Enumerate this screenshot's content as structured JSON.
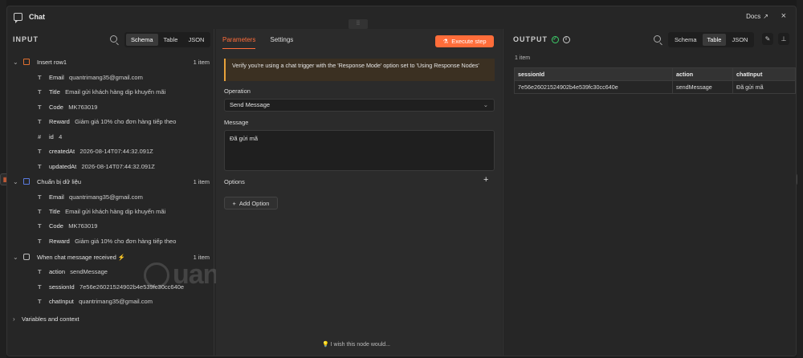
{
  "window": {
    "title": "Chat",
    "docs_label": "Docs",
    "close_glyph": "×"
  },
  "input": {
    "title": "INPUT",
    "view_tabs": [
      "Schema",
      "Table",
      "JSON"
    ],
    "nodes": [
      {
        "name": "Insert row1",
        "count": "1 item",
        "fields": [
          {
            "type": "T",
            "key": "Email",
            "value": "quantrimang35@gmail.com"
          },
          {
            "type": "T",
            "key": "Title",
            "value": "Email gửi khách hàng dịp khuyến mãi"
          },
          {
            "type": "T",
            "key": "Code",
            "value": "MK763019"
          },
          {
            "type": "T",
            "key": "Reward",
            "value": "Giảm giá 10% cho đơn hàng tiếp theo"
          },
          {
            "type": "#",
            "key": "id",
            "value": "4"
          },
          {
            "type": "T",
            "key": "createdAt",
            "value": "2026-08-14T07:44:32.091Z"
          },
          {
            "type": "T",
            "key": "updatedAt",
            "value": "2026-08-14T07:44:32.091Z"
          }
        ]
      },
      {
        "name": "Chuẩn bị dữ liệu",
        "count": "1 item",
        "fields": [
          {
            "type": "T",
            "key": "Email",
            "value": "quantrimang35@gmail.com"
          },
          {
            "type": "T",
            "key": "Title",
            "value": "Email gửi khách hàng dịp khuyến mãi"
          },
          {
            "type": "T",
            "key": "Code",
            "value": "MK763019"
          },
          {
            "type": "T",
            "key": "Reward",
            "value": "Giảm giá 10% cho đơn hàng tiếp theo"
          }
        ]
      },
      {
        "name": "When chat message received",
        "count": "1 item",
        "fields": [
          {
            "type": "T",
            "key": "action",
            "value": "sendMessage"
          },
          {
            "type": "T",
            "key": "sessionId",
            "value": "7e56e26021524902b4e539fc30cc640e"
          },
          {
            "type": "T",
            "key": "chatInput",
            "value": "quantrimang35@gmail.com"
          }
        ]
      }
    ],
    "variables_label": "Variables and context"
  },
  "params": {
    "tabs": [
      "Parameters",
      "Settings"
    ],
    "execute_label": "Execute step",
    "notice": "Verify you're using a chat trigger with the 'Response Mode' option set to 'Using Response Nodes'",
    "operation_label": "Operation",
    "operation_value": "Send Message",
    "message_label": "Message",
    "message_value": "Đã gửi mã",
    "options_label": "Options",
    "add_option_label": "Add Option",
    "wish_text": "I wish this node would..."
  },
  "output": {
    "title": "OUTPUT",
    "view_tabs": [
      "Schema",
      "Table",
      "JSON"
    ],
    "item_count": "1 item",
    "columns": [
      "sessionId",
      "action",
      "chatInput"
    ],
    "rows": [
      [
        "7e56e26021524902b4e539fc30cc640e",
        "sendMessage",
        "Đã gửi mã"
      ]
    ]
  },
  "watermark": "uantrimang",
  "colors": {
    "accent": "#ff6d3a",
    "success": "#3ecf6b",
    "notice_border": "#e8a23b"
  }
}
